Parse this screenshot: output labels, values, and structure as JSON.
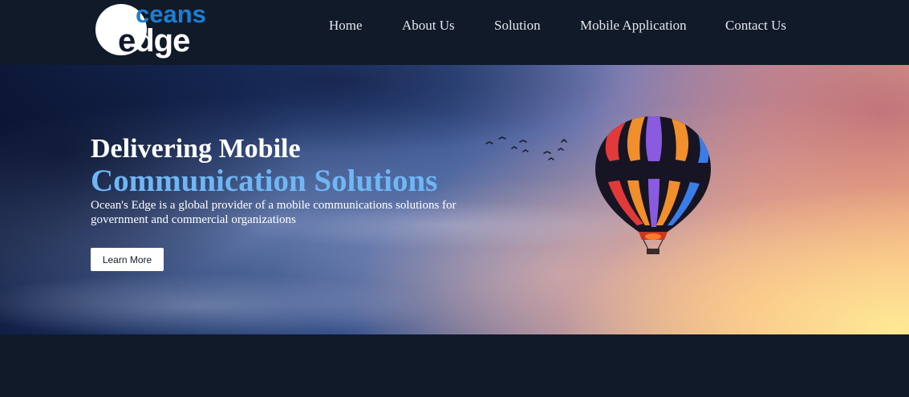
{
  "brand": {
    "logo_top": "ceans",
    "logo_bottom_first": "e",
    "logo_bottom_rest": "dge",
    "primary_color": "#1b7fd4",
    "background_color": "#111a29"
  },
  "nav": {
    "items": [
      {
        "label": "Home"
      },
      {
        "label": "About Us"
      },
      {
        "label": "Solution"
      },
      {
        "label": "Mobile Application"
      },
      {
        "label": "Contact Us"
      }
    ]
  },
  "hero": {
    "title_line1": "Delivering Mobile",
    "title_line2": "Communication Solutions",
    "description": "Ocean's Edge is a global provider of a mobile communications solutions for government and commercial organizations",
    "cta_label": "Learn More",
    "accent_color": "#6fb6f5",
    "image_icon": "hot-air-balloon-icon"
  }
}
